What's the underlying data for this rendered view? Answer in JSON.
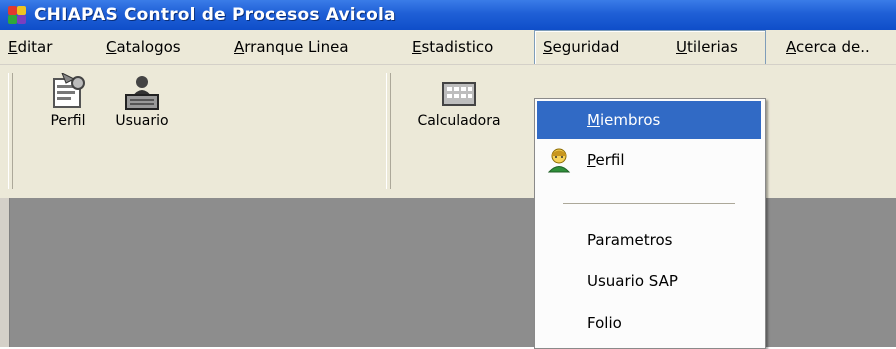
{
  "window": {
    "title": "CHIAPAS Control de Procesos Avicola",
    "icon": "app-colorful-icon"
  },
  "menubar": {
    "items": [
      {
        "label": "Editar",
        "accel": "E"
      },
      {
        "label": "Catalogos",
        "accel": "C"
      },
      {
        "label": "Arranque Linea",
        "accel": "A"
      },
      {
        "label": "Estadistico",
        "accel": "E"
      },
      {
        "label": "Seguridad",
        "accel": "S",
        "active": true
      },
      {
        "label": "Utilerias",
        "accel": "U"
      },
      {
        "label": "Acerca de..",
        "accel": "A"
      }
    ]
  },
  "toolbar": {
    "perfil_label": "Perfil",
    "usuario_label": "Usuario",
    "calculadora_label": "Calculadora"
  },
  "dropdown": {
    "items": [
      {
        "label": "Miembros",
        "accel": "M",
        "highlighted": true
      },
      {
        "label": "Perfil",
        "accel": "P",
        "icon": "user-profile-icon"
      },
      {
        "label": "Parametros"
      },
      {
        "label": "Usuario SAP"
      },
      {
        "label": "Folio"
      }
    ]
  },
  "colors": {
    "titlebar": "#1f5fd6",
    "menu_face": "#ece9d8",
    "highlight": "#316ac5",
    "workspace": "#8d8d8d"
  }
}
